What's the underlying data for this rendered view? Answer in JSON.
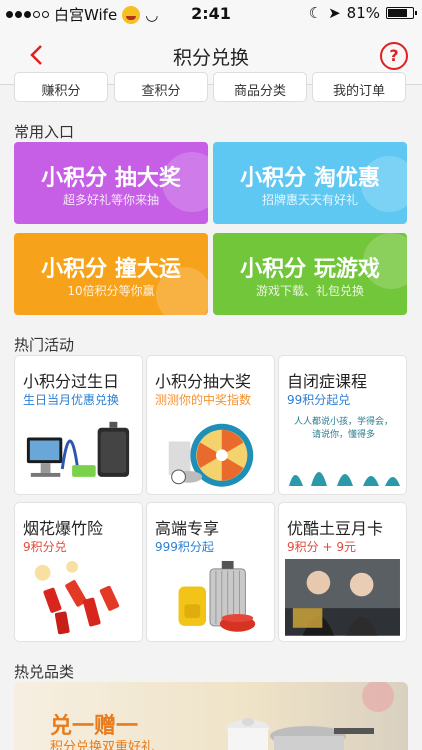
{
  "status_bar": {
    "carrier": "白宫Wife",
    "time": "2:41",
    "battery": "81%",
    "battery_level": 0.81
  },
  "nav": {
    "title": "积分兑换",
    "back_icon": "chevron-left-icon",
    "help_label": "?"
  },
  "tabs": [
    {
      "label": "赚积分"
    },
    {
      "label": "查积分"
    },
    {
      "label": "商品分类"
    },
    {
      "label": "我的订单"
    }
  ],
  "common_entries": {
    "section_title": "常用入口",
    "items": [
      {
        "title": "小积分 抽大奖",
        "subtitle": "超多好礼等你来抽",
        "color": "#c65ee6"
      },
      {
        "title": "小积分 淘优惠",
        "subtitle": "招牌惠天天有好礼",
        "color": "#5fc8f2"
      },
      {
        "title": "小积分 撞大运",
        "subtitle": "10倍积分等你赢",
        "color": "#f7a21b"
      },
      {
        "title": "小积分 玩游戏",
        "subtitle": "游戏下载、礼包兑换",
        "color": "#72c63a"
      }
    ]
  },
  "hot_activities": {
    "section_title": "热门活动",
    "cards": [
      {
        "title": "小积分过生日",
        "subtitle": "生日当月优惠兑换",
        "subtitle_color": "#2a7fd4"
      },
      {
        "title": "小积分抽大奖",
        "subtitle": "测测你的中奖指数",
        "subtitle_color": "#f29230"
      },
      {
        "title": "自闭症课程",
        "subtitle": "99积分起兑",
        "subtitle_color": "#2a7fd4"
      },
      {
        "title": "烟花爆竹险",
        "subtitle": "9积分兑",
        "subtitle_color": "#e24a3a"
      },
      {
        "title": "高端专享",
        "subtitle": "999积分起",
        "subtitle_color": "#2a7fd4"
      },
      {
        "title": "优酷土豆月卡",
        "subtitle": "9积分 + 9元",
        "subtitle_color": "#e24a3a"
      }
    ],
    "course_art_text": "人人都说小孩，学得会，请说你，懂得多"
  },
  "hot_categories": {
    "section_title": "热兑品类",
    "banner_title": "兑一赠一",
    "banner_subtitle": "积分兑换双重好礼"
  },
  "colors": {
    "accent_red": "#e02020"
  }
}
